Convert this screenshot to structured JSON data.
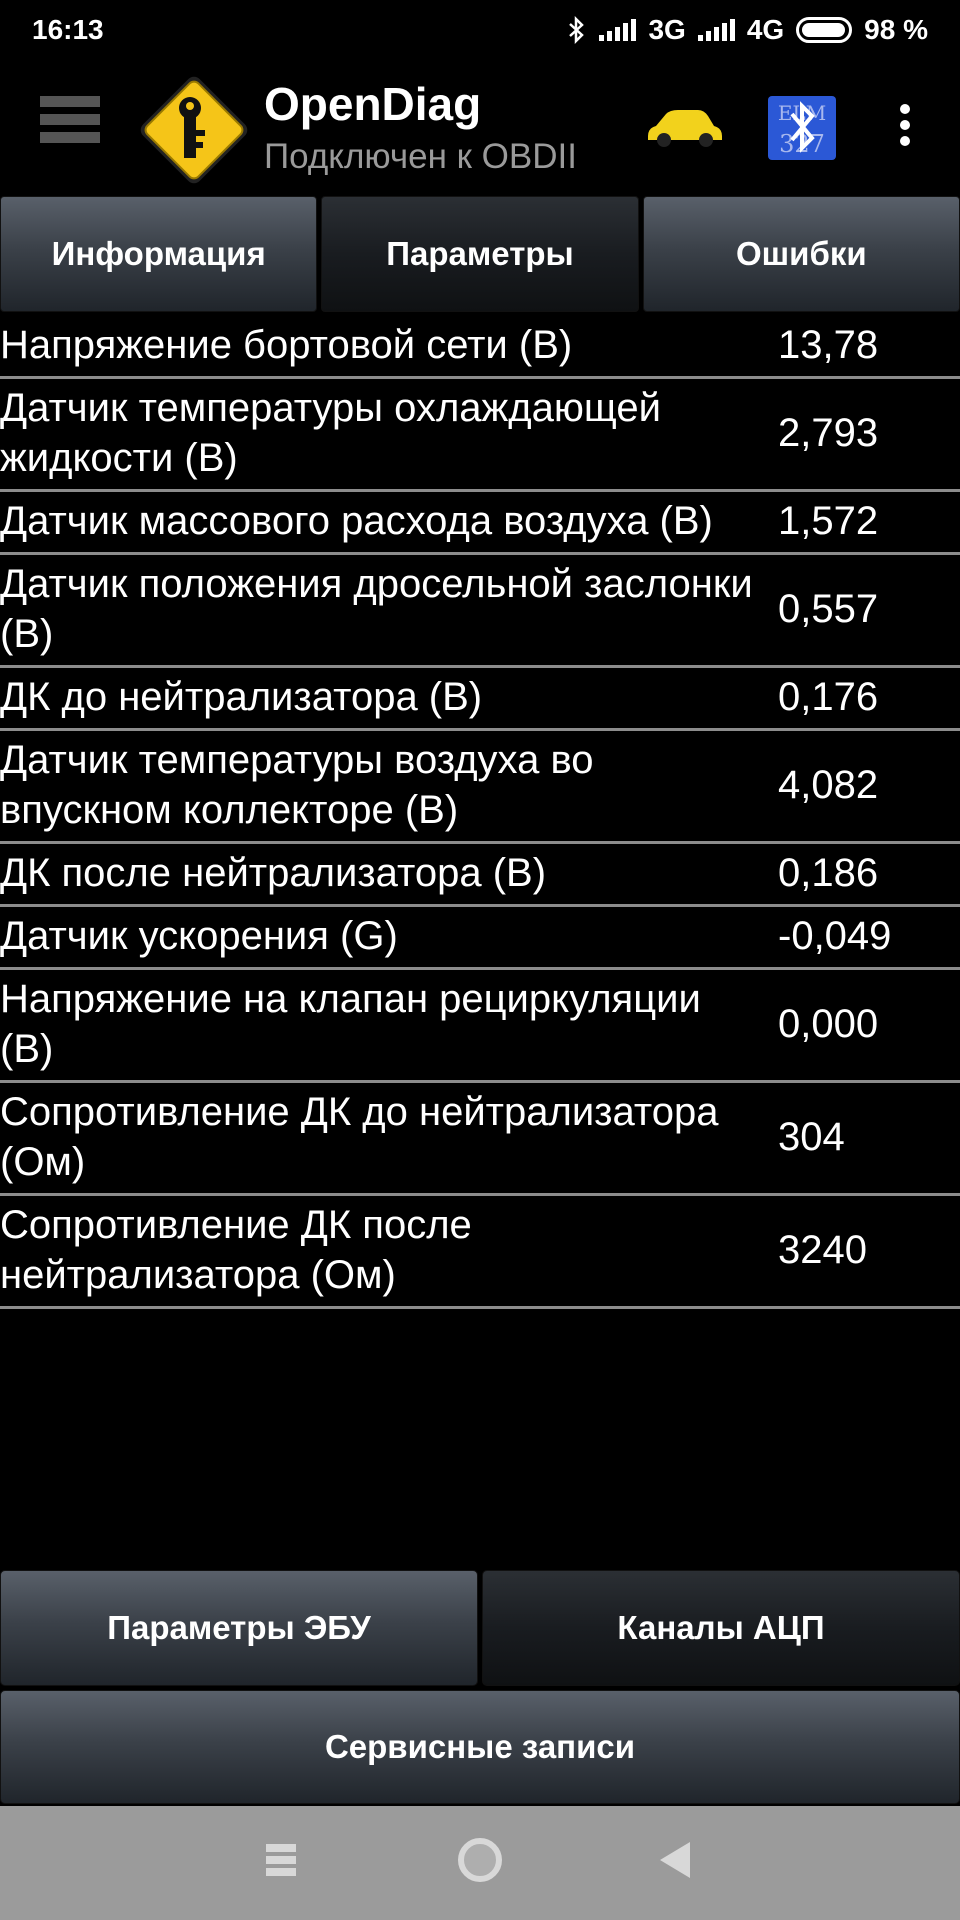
{
  "status_bar": {
    "time": "16:13",
    "network_3g": "3G",
    "network_4g": "4G",
    "battery": "98 %",
    "battery_level": 0.98
  },
  "app_bar": {
    "title": "OpenDiag",
    "subtitle": "Подключен к OBDII",
    "car_color": "#f2d21c",
    "bt_badge_text": "ELM 327",
    "bt_badge_color": "#2b58d6"
  },
  "tabs": [
    {
      "label": "Информация",
      "active": false
    },
    {
      "label": "Параметры",
      "active": true
    },
    {
      "label": "Ошибки",
      "active": false
    }
  ],
  "parameters": [
    {
      "name": "Напряжение бортовой сети (В)",
      "value": "13,78"
    },
    {
      "name": "Датчик температуры охлаждающей жидкости (В)",
      "value": "2,793"
    },
    {
      "name": "Датчик массового расхода воздуха (В)",
      "value": "1,572"
    },
    {
      "name": "Датчик положения дросельной заслонки (В)",
      "value": "0,557"
    },
    {
      "name": "ДК до нейтрализатора (В)",
      "value": "0,176"
    },
    {
      "name": "Датчик температуры воздуха во впускном коллекторе (В)",
      "value": "4,082"
    },
    {
      "name": "ДК после нейтрализатора (В)",
      "value": "0,186"
    },
    {
      "name": "Датчик ускорения (G)",
      "value": "-0,049"
    },
    {
      "name": "Напряжение на клапан рециркуляции (В)",
      "value": "0,000"
    },
    {
      "name": "Сопротивление ДК до нейтрализатора (Ом)",
      "value": "304"
    },
    {
      "name": "Сопротивление ДК после нейтрализатора (Ом)",
      "value": "3240"
    }
  ],
  "bottom_buttons": {
    "ecu_params": "Параметры ЭБУ",
    "adc_channels": "Каналы АЦП",
    "service_records": "Сервисные записи"
  }
}
